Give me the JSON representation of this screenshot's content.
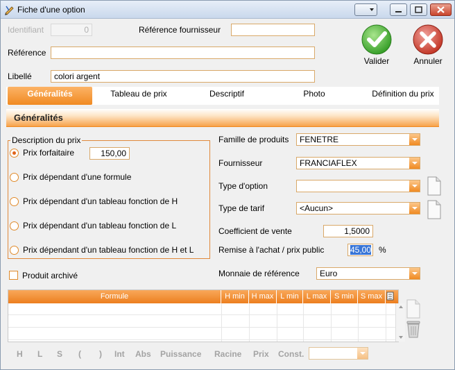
{
  "window": {
    "title": "Fiche d'une option"
  },
  "header": {
    "identifiant_label": "Identifiant",
    "identifiant_value": "0",
    "ref_fournisseur_label": "Référence fournisseur",
    "ref_fournisseur_value": "",
    "reference_label": "Référence",
    "reference_value": "",
    "libelle_label": "Libellé",
    "libelle_value": "colori argent"
  },
  "actions": {
    "valider": "Valider",
    "annuler": "Annuler"
  },
  "tabs": [
    {
      "label": "Généralités",
      "active": true
    },
    {
      "label": "Tableau de prix",
      "active": false
    },
    {
      "label": "Descriptif",
      "active": false
    },
    {
      "label": "Photo",
      "active": false
    },
    {
      "label": "Définition du prix",
      "active": false
    }
  ],
  "section_title": "Généralités",
  "prix": {
    "legend": "Description du prix",
    "options": [
      {
        "label": "Prix forfaitaire",
        "checked": true
      },
      {
        "label": "Prix dépendant d'une formule",
        "checked": false
      },
      {
        "label": "Prix dépendant d'un tableau fonction de H",
        "checked": false
      },
      {
        "label": "Prix dépendant d'un tableau fonction de L",
        "checked": false
      },
      {
        "label": "Prix dépendant d'un tableau fonction de H et L",
        "checked": false
      }
    ],
    "forfait_value": "150,00"
  },
  "archive": {
    "label": "Produit archivé",
    "checked": false
  },
  "right": {
    "famille_label": "Famille de produits",
    "famille_value": "FENETRE",
    "fournisseur_label": "Fournisseur",
    "fournisseur_value": "FRANCIAFLEX",
    "type_option_label": "Type d'option",
    "type_option_value": "",
    "type_tarif_label": "Type de tarif",
    "type_tarif_value": "<Aucun>",
    "coef_label": "Coefficient de vente",
    "coef_value": "1,5000",
    "remise_label": "Remise à l'achat / prix public",
    "remise_value": "45,00",
    "remise_unit": "%",
    "monnaie_label": "Monnaie de référence",
    "monnaie_value": "Euro"
  },
  "table": {
    "columns": [
      "Formule",
      "H min",
      "H max",
      "L min",
      "L max",
      "S min",
      "S max"
    ],
    "rows": []
  },
  "formula_buttons": [
    "H",
    "L",
    "S",
    "(",
    ")",
    "Int",
    "Abs",
    "Puissance",
    "Racine",
    "Prix",
    "Const."
  ],
  "const_value": "",
  "colors": {
    "accent": "#f08a22",
    "valider": "#3aa52a",
    "annuler": "#c8352a"
  }
}
